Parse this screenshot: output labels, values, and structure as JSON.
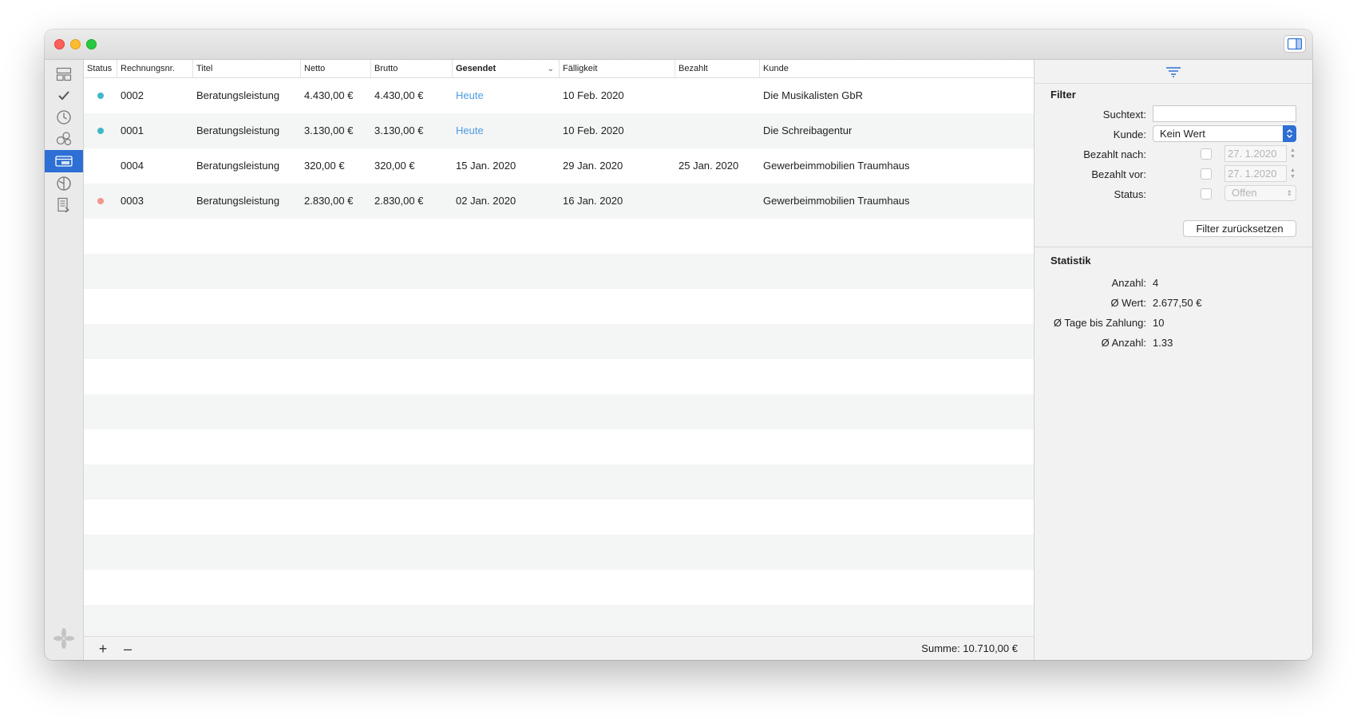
{
  "window": {
    "toolbar": {
      "inspector_toggle_icon": "sidebar-right-icon"
    }
  },
  "sidebar": {
    "items": [
      {
        "id": "dashboard",
        "icon": "dashboard-icon",
        "active": false
      },
      {
        "id": "tasks",
        "icon": "checkmark-icon",
        "active": false
      },
      {
        "id": "time",
        "icon": "clock-icon",
        "active": false
      },
      {
        "id": "clients",
        "icon": "people-icon",
        "active": false
      },
      {
        "id": "invoices",
        "icon": "invoice-icon",
        "active": true
      },
      {
        "id": "expenses",
        "icon": "chart-icon",
        "active": false
      },
      {
        "id": "reports",
        "icon": "document-icon",
        "active": false
      }
    ],
    "logo_icon": "app-logo-icon"
  },
  "table": {
    "columns": [
      {
        "key": "status",
        "label": "Status"
      },
      {
        "key": "nr",
        "label": "Rechnungsnr."
      },
      {
        "key": "titel",
        "label": "Titel"
      },
      {
        "key": "netto",
        "label": "Netto"
      },
      {
        "key": "brutto",
        "label": "Brutto"
      },
      {
        "key": "gesendet",
        "label": "Gesendet",
        "sorted": true
      },
      {
        "key": "faelligkeit",
        "label": "Fälligkeit"
      },
      {
        "key": "bezahlt",
        "label": "Bezahlt"
      },
      {
        "key": "kunde",
        "label": "Kunde"
      }
    ],
    "rows": [
      {
        "status_color": "#3fb8c9",
        "nr": "0002",
        "titel": "Beratungsleistung",
        "netto": "4.430,00 €",
        "brutto": "4.430,00 €",
        "gesendet": "Heute",
        "gesendet_link": true,
        "faelligkeit": "10 Feb. 2020",
        "bezahlt": "",
        "kunde": "Die Musikalisten GbR"
      },
      {
        "status_color": "#3fb8c9",
        "nr": "0001",
        "titel": "Beratungsleistung",
        "netto": "3.130,00 €",
        "brutto": "3.130,00 €",
        "gesendet": "Heute",
        "gesendet_link": true,
        "faelligkeit": "10 Feb. 2020",
        "bezahlt": "",
        "kunde": "Die Schreibagentur"
      },
      {
        "status_color": "",
        "nr": "0004",
        "titel": "Beratungsleistung",
        "netto": "320,00 €",
        "brutto": "320,00 €",
        "gesendet": "15 Jan. 2020",
        "gesendet_link": false,
        "faelligkeit": "29 Jan. 2020",
        "bezahlt": "25 Jan. 2020",
        "kunde": "Gewerbeimmobilien Traumhaus"
      },
      {
        "status_color": "#f2978a",
        "nr": "0003",
        "titel": "Beratungsleistung",
        "netto": "2.830,00 €",
        "brutto": "2.830,00 €",
        "gesendet": "02 Jan. 2020",
        "gesendet_link": false,
        "faelligkeit": "16 Jan. 2020",
        "bezahlt": "",
        "kunde": "Gewerbeimmobilien Traumhaus"
      }
    ],
    "footer": {
      "add_label": "+",
      "remove_label": "–",
      "sum": "Summe: 10.710,00 €"
    }
  },
  "inspector": {
    "filter_icon": "filter-icon",
    "filter": {
      "title": "Filter",
      "suchtext_label": "Suchtext:",
      "suchtext_value": "",
      "kunde_label": "Kunde:",
      "kunde_value": "Kein Wert",
      "bezahlt_nach_label": "Bezahlt nach:",
      "bezahlt_nach_date": "27.  1.2020",
      "bezahlt_vor_label": "Bezahlt vor:",
      "bezahlt_vor_date": "27.  1.2020",
      "status_label": "Status:",
      "status_value": "Offen",
      "reset_label": "Filter zurücksetzen"
    },
    "statistik": {
      "title": "Statistik",
      "anzahl_label": "Anzahl:",
      "anzahl_value": "4",
      "wert_label": "Ø Wert:",
      "wert_value": "2.677,50 €",
      "tage_label": "Ø Tage bis Zahlung:",
      "tage_value": "10",
      "anzahl2_label": "Ø Anzahl:",
      "anzahl2_value": "1.33"
    }
  }
}
